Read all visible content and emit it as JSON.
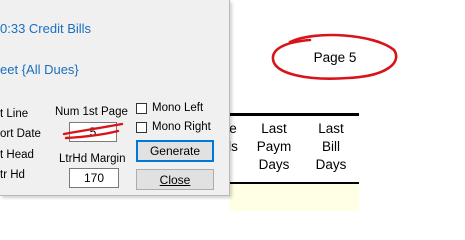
{
  "report": {
    "page_label": "Page 5",
    "columns": [
      {
        "lines": [
          "e",
          "ls",
          ""
        ]
      },
      {
        "lines": [
          "Last",
          "Paym",
          "Days"
        ]
      },
      {
        "lines": [
          "Last",
          "Bill",
          "Days"
        ]
      }
    ]
  },
  "dialog": {
    "title_link": "0:33 Credit Bills",
    "sheet_link": "eet {All Dues}",
    "left_labels": [
      "t Line",
      "ort Date",
      "t Head",
      "tr Hd"
    ],
    "num_first_page_label": "Num 1st Page",
    "num_first_page_value": "5",
    "ltrhd_margin_label": "LtrHd Margin",
    "ltrhd_margin_value": "170",
    "mono_left_label": "Mono Left",
    "mono_left_checked": false,
    "mono_right_label": "Mono Right",
    "mono_right_checked": false,
    "generate_label": "Generate",
    "close_label": "Close"
  },
  "colors": {
    "annotation_red": "#d8141a",
    "link_blue": "#1a6fbf",
    "focus_blue": "#0078d7",
    "band_yellow": "#ffffe4"
  }
}
